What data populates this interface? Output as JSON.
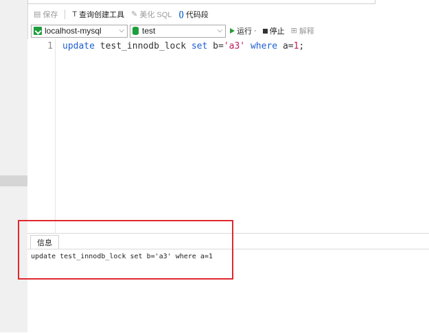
{
  "toolbar": {
    "save_label": "保存",
    "query_builder_label": "查询创建工具",
    "beautify_label": "美化 SQL",
    "snippet_label": "代码段"
  },
  "connection": {
    "selected": "localhost-mysql",
    "database": "test",
    "run_label": "运行",
    "stop_label": "停止",
    "explain_label": "解释"
  },
  "editor": {
    "line_number": "1",
    "tokens": {
      "kw_update": "update",
      "table": "test_innodb_lock",
      "kw_set": "set",
      "col_b": "b=",
      "str_val": "'a3'",
      "kw_where": "where",
      "cond": "a=",
      "num": "1",
      "end": ";"
    }
  },
  "info": {
    "tab_label": "信息",
    "message": "update test_innodb_lock set b='a3' where a=1"
  },
  "colors": {
    "keyword": "#1f5fd1",
    "string": "#c2185b",
    "accent_green": "#1e9e3c",
    "annotation_red": "#e0262d"
  }
}
